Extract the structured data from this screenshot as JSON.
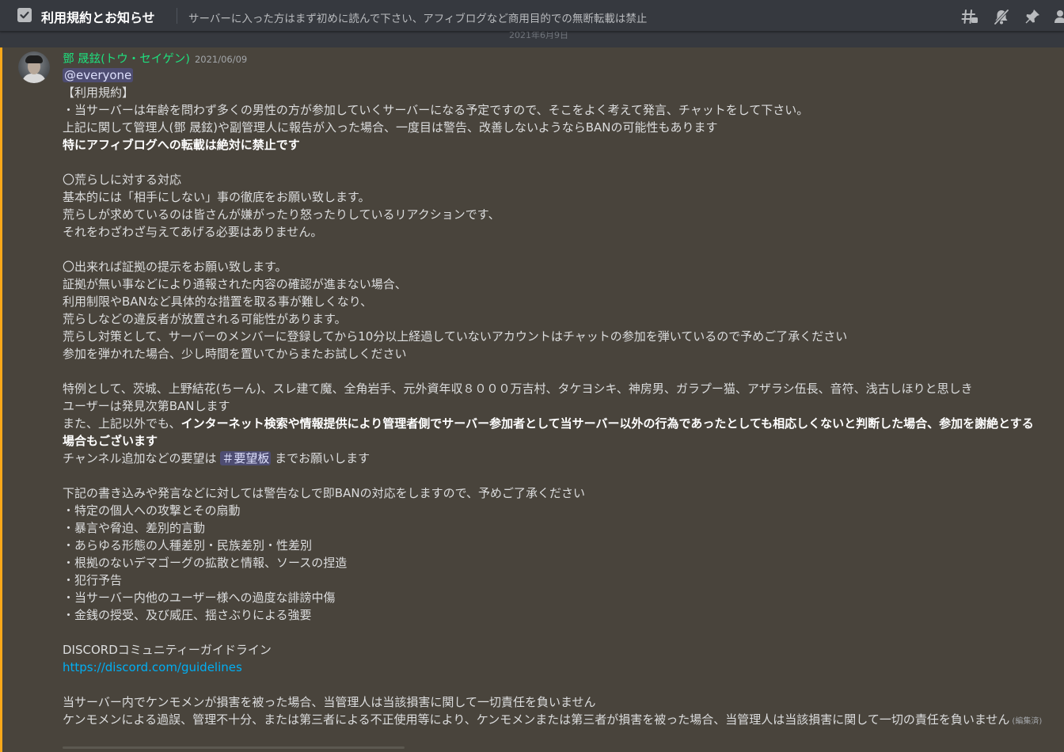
{
  "header": {
    "channel_name": "利用規約とお知らせ",
    "topic": "サーバーに入った方はまず初めに読んで下さい、アフィブログなど商用目的での無断転載は禁止"
  },
  "date_divider": "2021年6月9日",
  "message": {
    "author": "鄧 晟鉉(トウ・セイゲン)",
    "timestamp": "2021/06/09",
    "mention": "@everyone",
    "l1": "【利用規約】",
    "l2": "・当サーバーは年齢を問わず多くの男性の方が参加していくサーバーになる予定ですので、そこをよく考えて発言、チャットをして下さい。",
    "l3": "上記に関して管理人(鄧 晟鉉)や副管理人に報告が入った場合、一度目は警告、改善しないようならBANの可能性もあります",
    "l4": "特にアフィブログへの転載は絶対に禁止です",
    "l5": "〇荒らしに対する対応",
    "l6": "基本的には「相手にしない」事の徹底をお願い致します。",
    "l7": "荒らしが求めているのは皆さんが嫌がったり怒ったりしているリアクションです、",
    "l8": "それをわざわざ与えてあげる必要はありません。",
    "l9": "〇出来れば証拠の提示をお願い致します。",
    "l10": "証拠が無い事などにより通報された内容の確認が進まない場合、",
    "l11": "利用制限やBANなど具体的な措置を取る事が難しくなり、",
    "l12": "荒らしなどの違反者が放置される可能性があります。",
    "l13": "荒らし対策として、サーバーのメンバーに登録してから10分以上経過していないアカウントはチャットの参加を弾いているので予めご了承ください",
    "l14": "参加を弾かれた場合、少し時間を置いてからまたお試しください",
    "l15": "特例として、茨城、上野結花(ちーん)、スレ建て魔、全角岩手、元外資年収８０００万吉村、タケヨシキ、神房男、ガラプー猫、アザラシ伍長、音符、浅古しほりと思しき",
    "l16": "ユーザーは発見次第BANします",
    "l17_prefix": "また、上記以外でも、",
    "l17_bold": "インターネット検索や情報提供により管理者側でサーバー参加者として当サーバー以外の行為であったとしても相応しくないと判断した場合、参加を謝絶とする場合もございます",
    "l18_prefix": "チャンネル追加などの要望は",
    "l18_channel": "＃要望板",
    "l18_suffix": "までお願いします",
    "l19": "下記の書き込みや発言などに対しては警告なしで即BANの対応をしますので、予めご了承ください",
    "l20": "・特定の個人への攻撃とその扇動",
    "l21": "・暴言や脅迫、差別的言動",
    "l22": "・あらゆる形態の人種差別・民族差別・性差別",
    "l23": "・根拠のないデマゴーグの拡散と情報、ソースの捏造",
    "l24": "・犯行予告",
    "l25": "・当サーバー内他のユーザー様への過度な誹謗中傷",
    "l26": "・金銭の授受、及び威圧、揺さぶりによる強要",
    "l27": "DISCORDコミュニティーガイドライン",
    "l28_link": "https://discord.com/guidelines",
    "l29": "当サーバー内でケンモメンが損害を被った場合、当管理人は当該損害に関して一切責任を負いません",
    "l30": "ケンモメンによる過誤、管理不十分、または第三者による不正使用等により、ケンモメンまたは第三者が損害を被った場合、当管理人は当該損害に関して一切の責任を負いません",
    "edited": "(編集済)"
  },
  "icons": [
    "rules-channel-icon",
    "threads-icon",
    "mute-bell-icon",
    "pin-icon",
    "members-icon"
  ],
  "colors": {
    "background": "#36393f",
    "mention_highlight": "#49443c",
    "mention_bar": "#faa81a",
    "author": "#1ee07e",
    "link": "#00aff4"
  }
}
